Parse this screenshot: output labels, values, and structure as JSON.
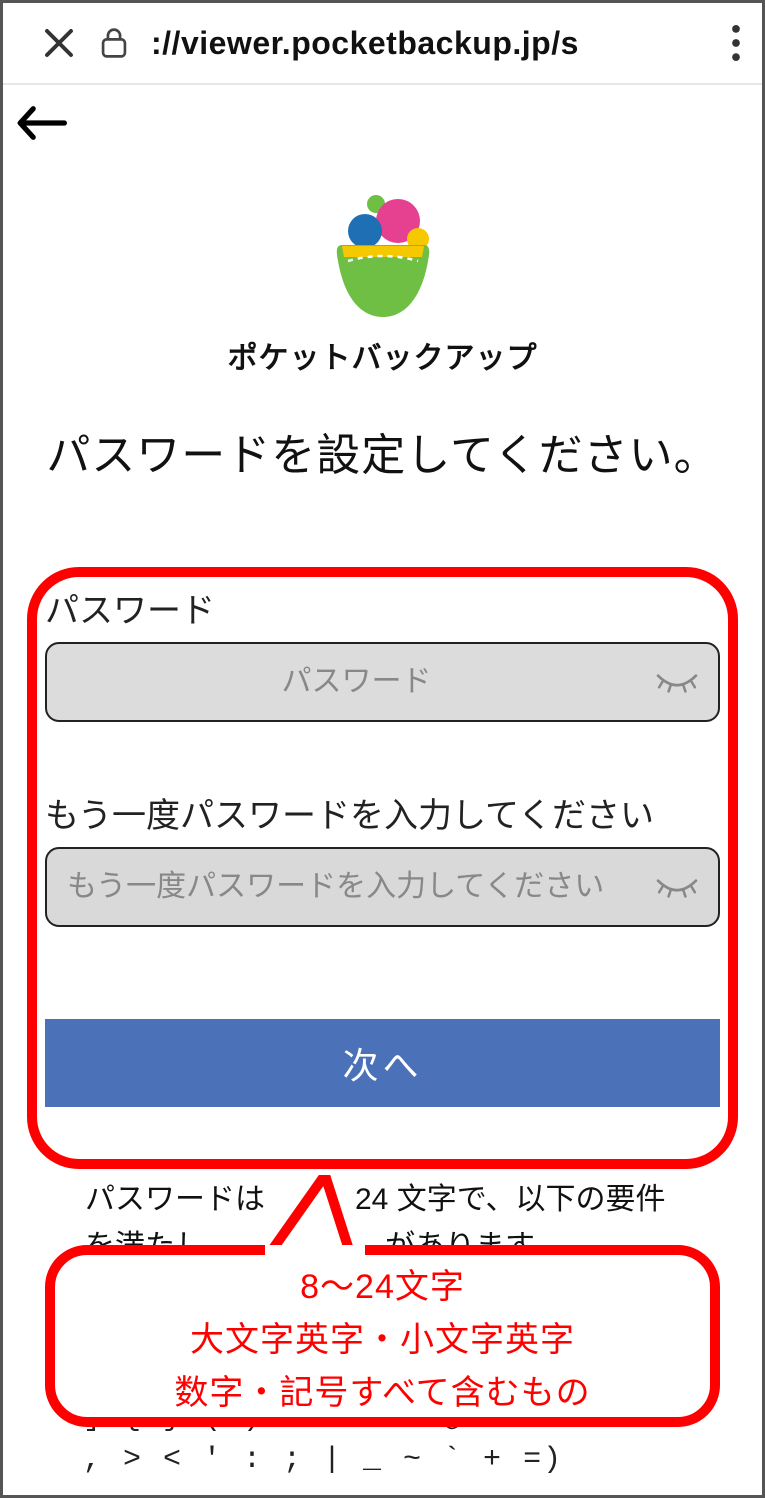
{
  "browser": {
    "url": "://viewer.pocketbackup.jp/s"
  },
  "logo": {
    "name": "ポケットバックアップ"
  },
  "page": {
    "title": "パスワードを設定してください。"
  },
  "form": {
    "password_label": "パスワード",
    "password_placeholder": "パスワード",
    "confirm_label": "もう一度パスワードを入力してください",
    "confirm_placeholder": "もう一度パスワードを入力してください",
    "next_button": "次へ"
  },
  "rules": {
    "text": "パスワードは　　　24 文字で、以下の要件を満たし　　　　　　があります"
  },
  "callout": {
    "line1": "8～24文字",
    "line2": "大文字英字・小文字英字",
    "line3": "数字・記号すべて含むもの"
  },
  "symbols": {
    "row": "] { } ( ) ? - \" ! @ # % & / \\ , > < ' : ; | _ ~ ` + =)"
  }
}
